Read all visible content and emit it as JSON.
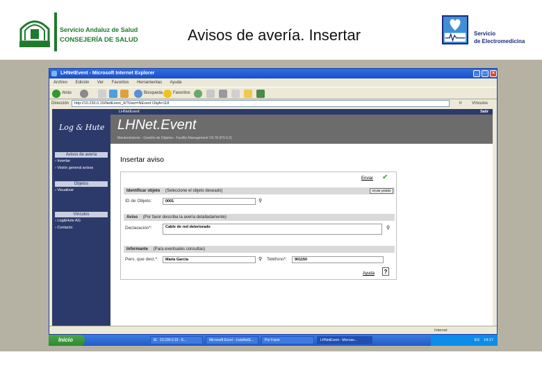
{
  "header": {
    "left_logo_line1": "Servicio Andaluz de Salud",
    "left_logo_line2": "CONSEJERÍA DE SALUD",
    "title": "Avisos de avería. Insertar",
    "right_logo_line1": "Servicio",
    "right_logo_line2": "de Electromedicina"
  },
  "browser": {
    "title": "LHNetEvent - Microsoft Internet Explorer",
    "menu": [
      "Archivo",
      "Edición",
      "Ver",
      "Favoritos",
      "Herramientas",
      "Ayuda"
    ],
    "toolbar": {
      "back": "Atrás",
      "search": "Búsqueda",
      "favorites": "Favoritos"
    },
    "address_label": "Dirección",
    "address_value": "http://10.230.0.15/NetEvent_9/?User=NEvent ObjA=118",
    "go_label": "Ir",
    "links_label": "Vínculos",
    "status_zone": "Internet"
  },
  "app": {
    "top_left": "LHNetEvent",
    "top_right": "Salir",
    "brand": "Log & Hute",
    "banner_title": "LHNet.Event",
    "banner_sub": "Mantenimiento - Gestión de Objetos - Facility Management V5.78 (PS 6.0)",
    "sidebar": [
      {
        "heading": "Avisos de avería",
        "items": [
          "Insertar",
          "Visión general avisos"
        ]
      },
      {
        "heading": "Objetos",
        "items": [
          "Visualizar"
        ]
      },
      {
        "heading": "Vínculos",
        "items": [
          "Log&Hute AG",
          "Contacto"
        ]
      }
    ],
    "page_title": "Insertar aviso",
    "send_label": "Enviar",
    "sections": {
      "object": {
        "title": "Identificar objeto",
        "hint": "(Seleccione el objeto deseado)",
        "button": "enviar pedido"
      },
      "notice": {
        "title": "Aviso",
        "hint": "(Por favor describa la avería detalladamente)"
      },
      "reporter": {
        "title": "Informante",
        "hint": "(Para eventuales consultas)"
      }
    },
    "fields": {
      "object_id": {
        "label": "ID de Objeto:",
        "value": "0001"
      },
      "declaration": {
        "label": "Declaración*:",
        "value": "Cable de red deteriorado"
      },
      "person": {
        "label": "Pers. que decl.*:",
        "value": "María García"
      },
      "phone": {
        "label": "Teléfono*:",
        "value": "901150"
      }
    },
    "help_label": "Ayuda"
  },
  "taskbar": {
    "start": "Inicio",
    "tasks": [
      "IE - 10.230.0.15 - E...",
      "Microsoft Excel - ListaNetE...",
      "Por Favor",
      "LHNetEvent - Microso..."
    ],
    "lang": "ES",
    "clock": "14:17"
  }
}
